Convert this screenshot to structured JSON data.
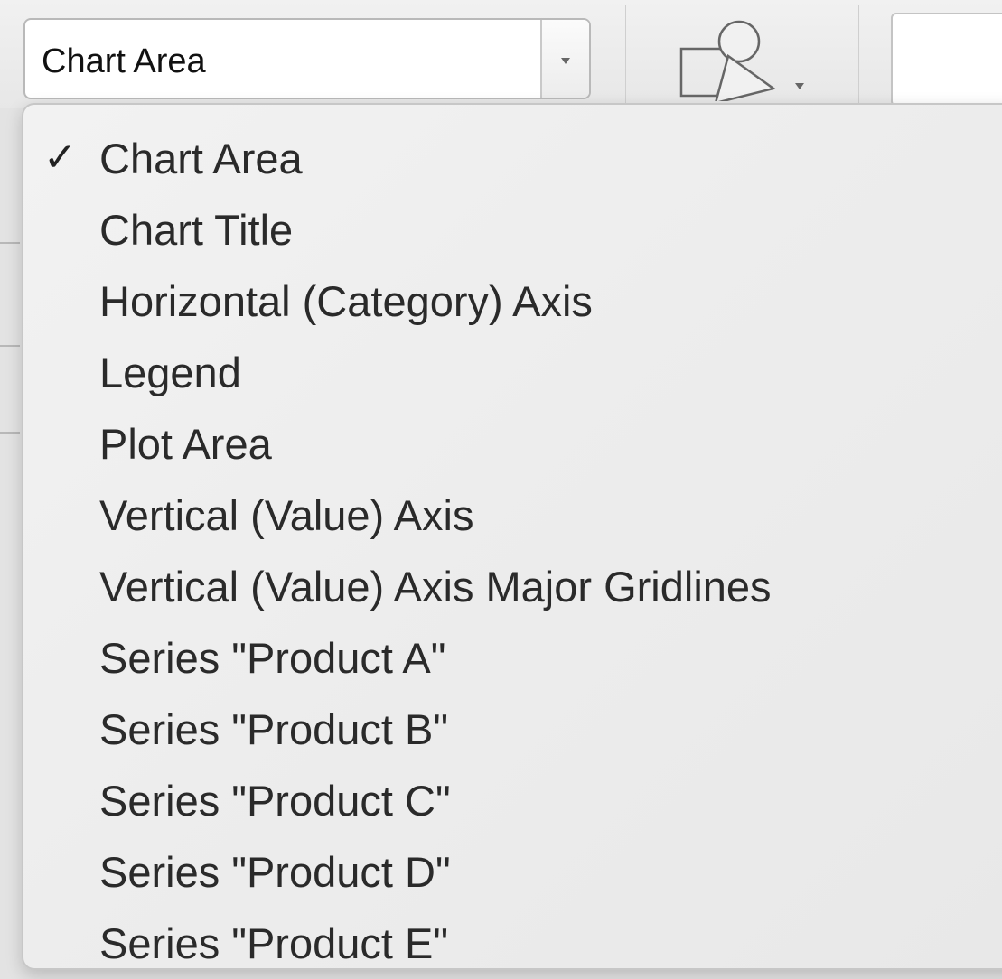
{
  "toolbar": {
    "selection_combo": {
      "value": "Chart Area"
    },
    "shapes_button_icon": "shapes-icon",
    "dropdown_arrow_icon": "chevron-down-icon"
  },
  "menu": {
    "checkmark": "✓",
    "selected_index": 0,
    "items": [
      {
        "label": "Chart Area",
        "checked": true
      },
      {
        "label": "Chart Title",
        "checked": false
      },
      {
        "label": "Horizontal (Category) Axis",
        "checked": false
      },
      {
        "label": "Legend",
        "checked": false
      },
      {
        "label": "Plot Area",
        "checked": false
      },
      {
        "label": "Vertical (Value) Axis",
        "checked": false
      },
      {
        "label": "Vertical (Value) Axis Major Gridlines",
        "checked": false
      },
      {
        "label": "Series \"Product A\"",
        "checked": false
      },
      {
        "label": "Series \"Product B\"",
        "checked": false
      },
      {
        "label": "Series \"Product C\"",
        "checked": false
      },
      {
        "label": "Series \"Product D\"",
        "checked": false
      },
      {
        "label": "Series \"Product E\"",
        "checked": false
      }
    ]
  }
}
